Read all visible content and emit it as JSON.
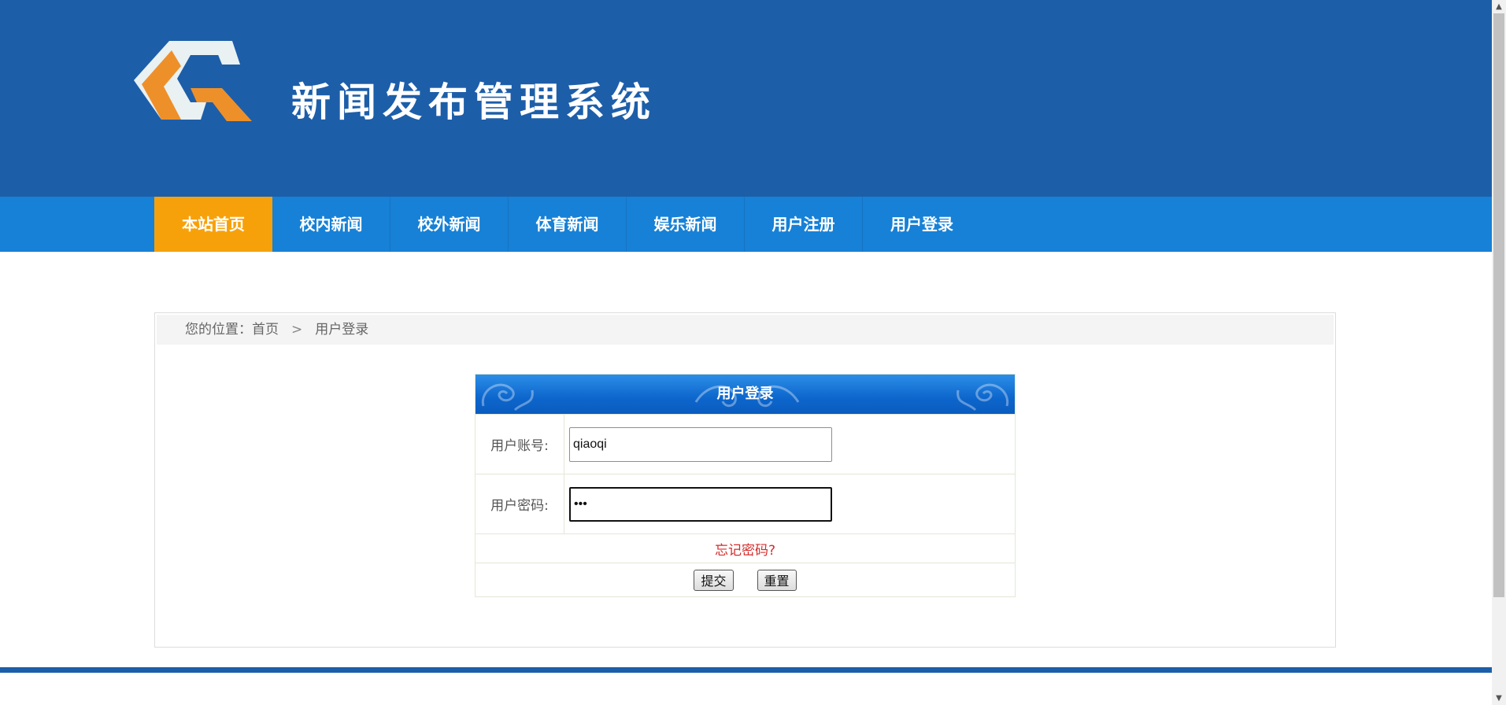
{
  "site": {
    "title": "新闻发布管理系统"
  },
  "nav": {
    "items": [
      {
        "label": "本站首页",
        "active": true
      },
      {
        "label": "校内新闻"
      },
      {
        "label": "校外新闻"
      },
      {
        "label": "体育新闻"
      },
      {
        "label": "娱乐新闻"
      },
      {
        "label": "用户注册"
      },
      {
        "label": "用户登录"
      }
    ]
  },
  "breadcrumb": {
    "prefix": "您的位置：",
    "home": "首页",
    "separator": ">",
    "current": "用户登录"
  },
  "login": {
    "title": "用户登录",
    "username_label": "用户账号:",
    "username_value": "qiaoqi",
    "password_label": "用户密码:",
    "password_value": "•••",
    "forgot": "忘记密码?",
    "submit": "提交",
    "reset": "重置"
  },
  "colors": {
    "header": "#1d5ea9",
    "nav": "#1681d6",
    "nav_active": "#f7a10a",
    "forgot_link": "#d62c2c"
  }
}
